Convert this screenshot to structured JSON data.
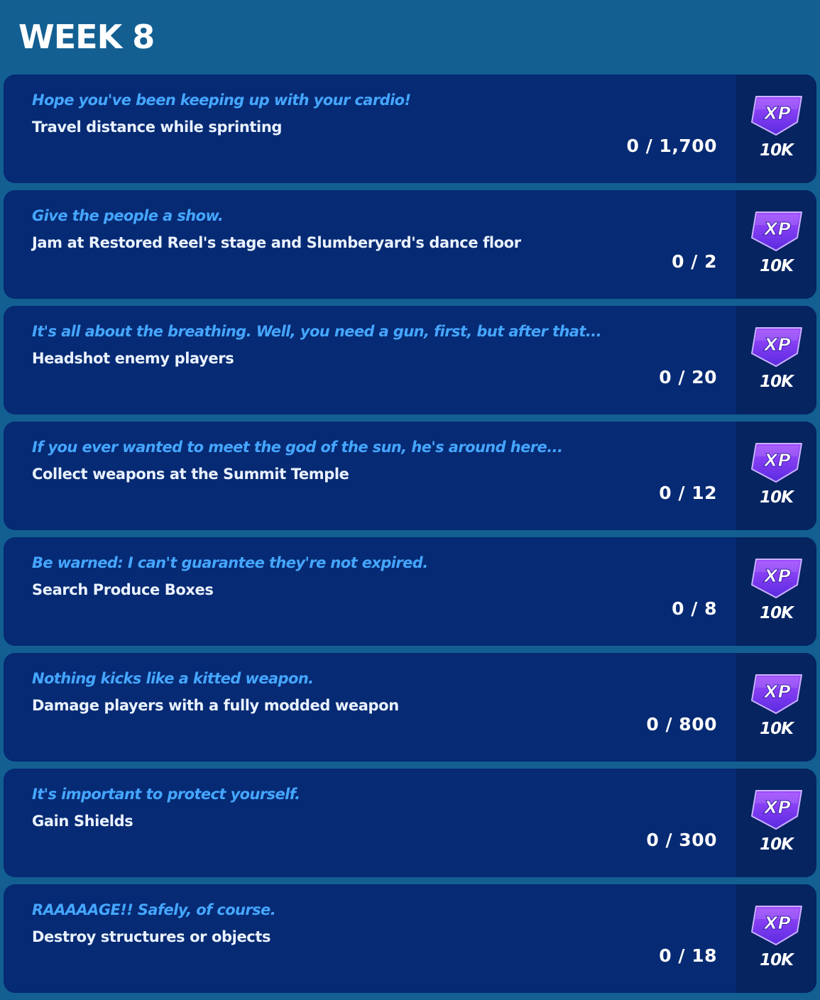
{
  "header": {
    "title": "WEEK 8"
  },
  "quests": [
    {
      "flavor": "Hope you've been keeping up with your cardio!",
      "task": "Travel distance while sprinting",
      "progress": "0 / 1,700",
      "reward_icon": "xp-icon",
      "reward_label": "XP",
      "reward_amount": "10K"
    },
    {
      "flavor": "Give the people a show.",
      "task": "Jam at Restored Reel's stage and Slumberyard's dance floor",
      "progress": "0 / 2",
      "reward_icon": "xp-icon",
      "reward_label": "XP",
      "reward_amount": "10K"
    },
    {
      "flavor": "It's all about the breathing. Well, you need a gun, first, but after that...",
      "task": "Headshot enemy players",
      "progress": "0 / 20",
      "reward_icon": "xp-icon",
      "reward_label": "XP",
      "reward_amount": "10K"
    },
    {
      "flavor": "If you ever wanted to meet the god of the sun, he's around here...",
      "task": "Collect weapons at the Summit Temple",
      "progress": "0 / 12",
      "reward_icon": "xp-icon",
      "reward_label": "XP",
      "reward_amount": "10K"
    },
    {
      "flavor": "Be warned: I can't guarantee they're not expired.",
      "task": "Search Produce Boxes",
      "progress": "0 / 8",
      "reward_icon": "xp-icon",
      "reward_label": "XP",
      "reward_amount": "10K"
    },
    {
      "flavor": "Nothing kicks like a kitted weapon.",
      "task": "Damage players with a fully modded weapon",
      "progress": "0 / 800",
      "reward_icon": "xp-icon",
      "reward_label": "XP",
      "reward_amount": "10K"
    },
    {
      "flavor": "It's important to protect yourself.",
      "task": "Gain Shields",
      "progress": "0 / 300",
      "reward_icon": "xp-icon",
      "reward_label": "XP",
      "reward_amount": "10K"
    },
    {
      "flavor": "RAAAAAGE!! Safely, of course.",
      "task": "Destroy structures or objects",
      "progress": "0 / 18",
      "reward_icon": "xp-icon",
      "reward_label": "XP",
      "reward_amount": "10K"
    }
  ],
  "colors": {
    "background": "#135f92",
    "card": "#062a73",
    "reward_panel": "#052460",
    "flavor_text": "#45a6ff",
    "task_text": "#eaf2ff",
    "badge_top": "#a14bff",
    "badge_bottom": "#5b2be0"
  }
}
